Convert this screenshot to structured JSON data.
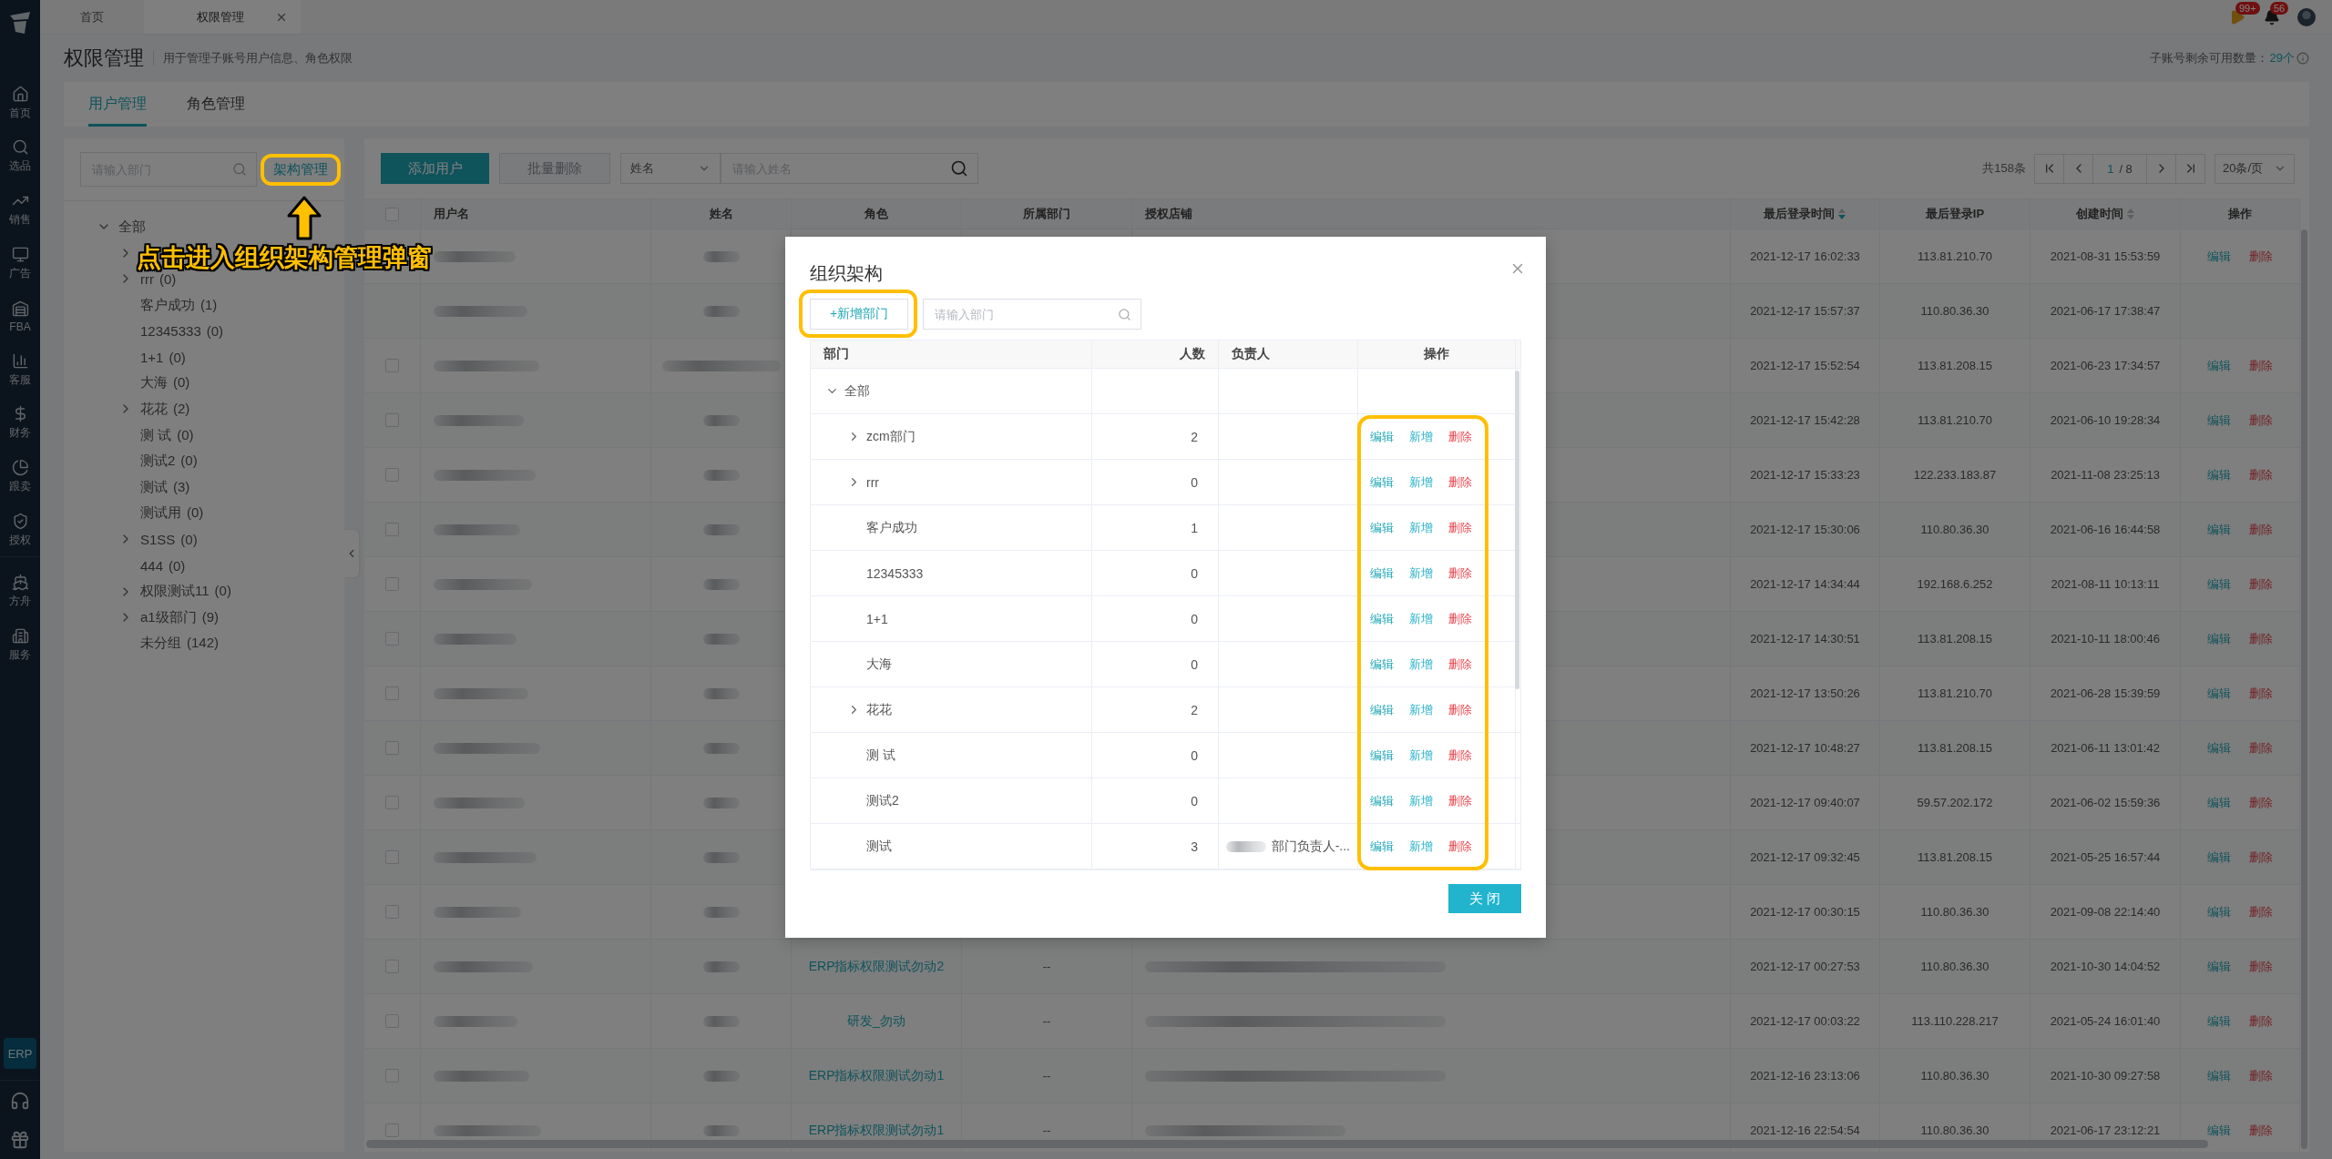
{
  "top_tabs": [
    {
      "label": "首页",
      "selected": false,
      "closable": false
    },
    {
      "label": "权限管理",
      "selected": true,
      "closable": true
    }
  ],
  "notifications": [
    {
      "kind": "flag",
      "badge": "99+"
    },
    {
      "kind": "bell",
      "badge": "56"
    }
  ],
  "sidebar": {
    "main_items": [
      {
        "label": "首页"
      },
      {
        "label": "选品"
      },
      {
        "label": "销售"
      },
      {
        "label": "广告"
      },
      {
        "label": "FBA"
      },
      {
        "label": "客服"
      },
      {
        "label": "财务"
      },
      {
        "label": "跟卖"
      },
      {
        "label": "授权"
      }
    ],
    "extra_items": [
      {
        "label": "方舟"
      },
      {
        "label": "服务"
      }
    ],
    "erp_badge": "ERP"
  },
  "header": {
    "title": "权限管理",
    "subtitle": "用于管理子账号用户信息、角色权限",
    "quota_label": "子账号剩余可用数量：",
    "quota_value": "29个"
  },
  "page_tabs": [
    {
      "label": "用户管理",
      "selected": true
    },
    {
      "label": "角色管理",
      "selected": false
    }
  ],
  "dept_panel": {
    "search_placeholder": "请输入部门",
    "manage_button": {
      "label": "架构管理",
      "highlighted": true
    },
    "tree": [
      {
        "label": "全部",
        "expanded": true,
        "children": [
          {
            "kind": "group"
          },
          {
            "label": "rrr",
            "count": "(0)",
            "kind": "group"
          },
          {
            "label": "客户成功",
            "count": "(1)",
            "kind": "leaf"
          },
          {
            "label": "12345333",
            "count": "(0)",
            "kind": "leaf"
          },
          {
            "label": "1+1",
            "count": "(0)",
            "kind": "leaf"
          },
          {
            "label": "大海",
            "count": "(0)",
            "kind": "leaf"
          },
          {
            "label": "花花",
            "count": "(2)",
            "kind": "group"
          },
          {
            "label": "测 试",
            "count": "(0)",
            "kind": "leaf"
          },
          {
            "label": "测试2",
            "count": "(0)",
            "kind": "leaf"
          },
          {
            "label": "测试",
            "count": "(3)",
            "kind": "leaf"
          },
          {
            "label": "测试用",
            "count": "(0)",
            "kind": "leaf"
          },
          {
            "label": "S1SS",
            "count": "(0)",
            "kind": "group"
          },
          {
            "label": "444",
            "count": "(0)",
            "kind": "leaf"
          },
          {
            "label": "权限测试11",
            "count": "(0)",
            "kind": "group"
          },
          {
            "label": "a1级部门",
            "count": "(9)",
            "kind": "group"
          },
          {
            "label": "未分组",
            "count": "(142)",
            "kind": "leaf"
          }
        ]
      }
    ]
  },
  "toolbar": {
    "add_button": "添加用户",
    "batch_delete": {
      "label": "批量删除",
      "disabled": true
    },
    "field_select": "姓名",
    "search_placeholder": "请输入姓名"
  },
  "pagination": {
    "total": "共158条",
    "page": "1",
    "pages": "/ 8",
    "page_size": "20条/页"
  },
  "table": {
    "columns": [
      {
        "kind": "checkbox",
        "checked": false
      },
      {
        "label": "用户名",
        "kind": "text"
      },
      {
        "label": "姓名",
        "kind": "text"
      },
      {
        "label": "角色",
        "kind": "text"
      },
      {
        "label": "所属部门",
        "kind": "text"
      },
      {
        "label": "授权店铺",
        "kind": "text"
      },
      {
        "label": "最后登录时间",
        "kind": "sortable",
        "sorted": true
      },
      {
        "label": "最后登录IP",
        "kind": "text"
      },
      {
        "label": "创建时间",
        "kind": "sortable",
        "sorted": false
      },
      {
        "label": "操作",
        "kind": "text"
      }
    ],
    "rows": [
      {
        "kind": "plain",
        "last_login": "2021-12-17 16:02:33",
        "ip": "113.81.210.70",
        "created": "2021-08-31 15:53:59",
        "actions": [
          {
            "label": "编辑",
            "kind": "edit"
          },
          {
            "label": "删除",
            "kind": "delete"
          }
        ]
      },
      {
        "kind": "plain",
        "last_login": "2021-12-17 15:57:37",
        "ip": "110.80.36.30",
        "created": "2021-06-17 17:38:47"
      },
      {
        "kind": "selectable",
        "checked": false,
        "last_login": "2021-12-17 15:52:54",
        "ip": "113.81.208.15",
        "created": "2021-06-23 17:34:57",
        "actions": [
          {
            "label": "编辑",
            "kind": "edit"
          },
          {
            "label": "删除",
            "kind": "delete"
          }
        ]
      },
      {
        "kind": "selectable",
        "checked": false,
        "last_login": "2021-12-17 15:42:28",
        "ip": "113.81.210.70",
        "created": "2021-06-10 19:28:34",
        "actions": [
          {
            "label": "编辑",
            "kind": "edit"
          },
          {
            "label": "删除",
            "kind": "delete"
          }
        ]
      },
      {
        "kind": "selectable",
        "checked": false,
        "last_login": "2021-12-17 15:33:23",
        "ip": "122.233.183.87",
        "created": "2021-11-08 23:25:13",
        "actions": [
          {
            "label": "编辑",
            "kind": "edit"
          },
          {
            "label": "删除",
            "kind": "delete"
          }
        ]
      },
      {
        "kind": "selectable",
        "checked": false,
        "last_login": "2021-12-17 15:30:06",
        "ip": "110.80.36.30",
        "created": "2021-06-16 16:44:58",
        "actions": [
          {
            "label": "编辑",
            "kind": "edit"
          },
          {
            "label": "删除",
            "kind": "delete"
          }
        ]
      },
      {
        "kind": "selectable",
        "checked": false,
        "last_login": "2021-12-17 14:34:44",
        "ip": "192.168.6.252",
        "created": "2021-08-11 10:13:11",
        "actions": [
          {
            "label": "编辑",
            "kind": "edit"
          },
          {
            "label": "删除",
            "kind": "delete"
          }
        ]
      },
      {
        "kind": "selectable",
        "checked": false,
        "last_login": "2021-12-17 14:30:51",
        "ip": "113.81.208.15",
        "created": "2021-10-11 18:00:46",
        "actions": [
          {
            "label": "编辑",
            "kind": "edit"
          },
          {
            "label": "删除",
            "kind": "delete"
          }
        ]
      },
      {
        "kind": "selectable",
        "checked": false,
        "last_login": "2021-12-17 13:50:26",
        "ip": "113.81.210.70",
        "created": "2021-06-28 15:39:59",
        "actions": [
          {
            "label": "编辑",
            "kind": "edit"
          },
          {
            "label": "删除",
            "kind": "delete"
          }
        ]
      },
      {
        "kind": "selectable",
        "checked": false,
        "last_login": "2021-12-17 10:48:27",
        "ip": "113.81.208.15",
        "created": "2021-06-11 13:01:42",
        "actions": [
          {
            "label": "编辑",
            "kind": "edit"
          },
          {
            "label": "删除",
            "kind": "delete"
          }
        ]
      },
      {
        "kind": "selectable",
        "checked": false,
        "last_login": "2021-12-17 09:40:07",
        "ip": "59.57.202.172",
        "created": "2021-06-02 15:59:36",
        "actions": [
          {
            "label": "编辑",
            "kind": "edit"
          },
          {
            "label": "删除",
            "kind": "delete"
          }
        ]
      },
      {
        "kind": "selectable",
        "checked": false,
        "last_login": "2021-12-17 09:32:45",
        "ip": "113.81.208.15",
        "created": "2021-05-25 16:57:44",
        "actions": [
          {
            "label": "编辑",
            "kind": "edit"
          },
          {
            "label": "删除",
            "kind": "delete"
          }
        ]
      },
      {
        "kind": "selectable",
        "checked": false,
        "last_login": "2021-12-17 00:30:15",
        "ip": "110.80.36.30",
        "created": "2021-09-08 22:14:40",
        "actions": [
          {
            "label": "编辑",
            "kind": "edit"
          },
          {
            "label": "删除",
            "kind": "delete"
          }
        ]
      },
      {
        "kind": "selectable",
        "checked": false,
        "role": "ERP指标权限测试勿动2",
        "dept": "--",
        "last_login": "2021-12-17 00:27:53",
        "ip": "110.80.36.30",
        "created": "2021-10-30 14:04:52",
        "actions": [
          {
            "label": "编辑",
            "kind": "edit"
          },
          {
            "label": "删除",
            "kind": "delete"
          }
        ]
      },
      {
        "kind": "selectable",
        "checked": false,
        "role": "研发_勿动",
        "dept": "--",
        "last_login": "2021-12-17 00:03:22",
        "ip": "113.110.228.217",
        "created": "2021-05-24 16:01:40",
        "actions": [
          {
            "label": "编辑",
            "kind": "edit"
          },
          {
            "label": "删除",
            "kind": "delete"
          }
        ]
      },
      {
        "kind": "selectable",
        "checked": false,
        "role": "ERP指标权限测试勿动1",
        "dept": "--",
        "last_login": "2021-12-16 23:13:06",
        "ip": "110.80.36.30",
        "created": "2021-10-30 09:27:58",
        "actions": [
          {
            "label": "编辑",
            "kind": "edit"
          },
          {
            "label": "删除",
            "kind": "delete"
          }
        ]
      },
      {
        "kind": "selectable",
        "checked": false,
        "role": "ERP指标权限测试勿动1",
        "dept": "--",
        "last_login": "2021-12-16 22:54:54",
        "ip": "110.80.36.30",
        "created": "2021-06-17 23:12:21",
        "actions": [
          {
            "label": "编辑",
            "kind": "edit"
          },
          {
            "label": "删除",
            "kind": "delete"
          }
        ]
      }
    ]
  },
  "modal": {
    "title": "组织架构",
    "add_button": {
      "label": "+新增部门",
      "highlighted": true
    },
    "search_placeholder": "请输入部门",
    "columns": [
      "部门",
      "人数",
      "负责人",
      "操作"
    ],
    "actions_highlighted": true,
    "tree": [
      {
        "label": "全部",
        "expanded": true,
        "children": [
          {
            "label": "zcm部门",
            "kind": "group",
            "count": "2",
            "actions": [
              {
                "label": "编辑",
                "kind": "edit"
              },
              {
                "label": "新增",
                "kind": "add"
              },
              {
                "label": "删除",
                "kind": "delete"
              }
            ]
          },
          {
            "label": "rrr",
            "kind": "group",
            "count": "0",
            "actions": [
              {
                "label": "编辑",
                "kind": "edit"
              },
              {
                "label": "新增",
                "kind": "add"
              },
              {
                "label": "删除",
                "kind": "delete"
              }
            ]
          },
          {
            "label": "客户成功",
            "kind": "leaf",
            "count": "1",
            "actions": [
              {
                "label": "编辑",
                "kind": "edit"
              },
              {
                "label": "新增",
                "kind": "add"
              },
              {
                "label": "删除",
                "kind": "delete"
              }
            ]
          },
          {
            "label": "12345333",
            "kind": "leaf",
            "count": "0",
            "actions": [
              {
                "label": "编辑",
                "kind": "edit"
              },
              {
                "label": "新增",
                "kind": "add"
              },
              {
                "label": "删除",
                "kind": "delete"
              }
            ]
          },
          {
            "label": "1+1",
            "kind": "leaf",
            "count": "0",
            "actions": [
              {
                "label": "编辑",
                "kind": "edit"
              },
              {
                "label": "新增",
                "kind": "add"
              },
              {
                "label": "删除",
                "kind": "delete"
              }
            ]
          },
          {
            "label": "大海",
            "kind": "leaf",
            "count": "0",
            "actions": [
              {
                "label": "编辑",
                "kind": "edit"
              },
              {
                "label": "新增",
                "kind": "add"
              },
              {
                "label": "删除",
                "kind": "delete"
              }
            ]
          },
          {
            "label": "花花",
            "kind": "group",
            "count": "2",
            "actions": [
              {
                "label": "编辑",
                "kind": "edit"
              },
              {
                "label": "新增",
                "kind": "add"
              },
              {
                "label": "删除",
                "kind": "delete"
              }
            ]
          },
          {
            "label": "测 试",
            "kind": "leaf",
            "count": "0",
            "actions": [
              {
                "label": "编辑",
                "kind": "edit"
              },
              {
                "label": "新增",
                "kind": "add"
              },
              {
                "label": "删除",
                "kind": "delete"
              }
            ]
          },
          {
            "label": "测试2",
            "kind": "leaf",
            "count": "0",
            "actions": [
              {
                "label": "编辑",
                "kind": "edit"
              },
              {
                "label": "新增",
                "kind": "add"
              },
              {
                "label": "删除",
                "kind": "delete"
              }
            ]
          },
          {
            "label": "测试",
            "kind": "leaf",
            "count": "3",
            "owner": "部门负责人-...",
            "actions": [
              {
                "label": "编辑",
                "kind": "edit"
              },
              {
                "label": "新增",
                "kind": "add"
              },
              {
                "label": "删除",
                "kind": "delete"
              }
            ]
          }
        ]
      }
    ],
    "close_button": "关 闭"
  },
  "callout": {
    "text": "点击进入组织架构管理弹窗"
  }
}
